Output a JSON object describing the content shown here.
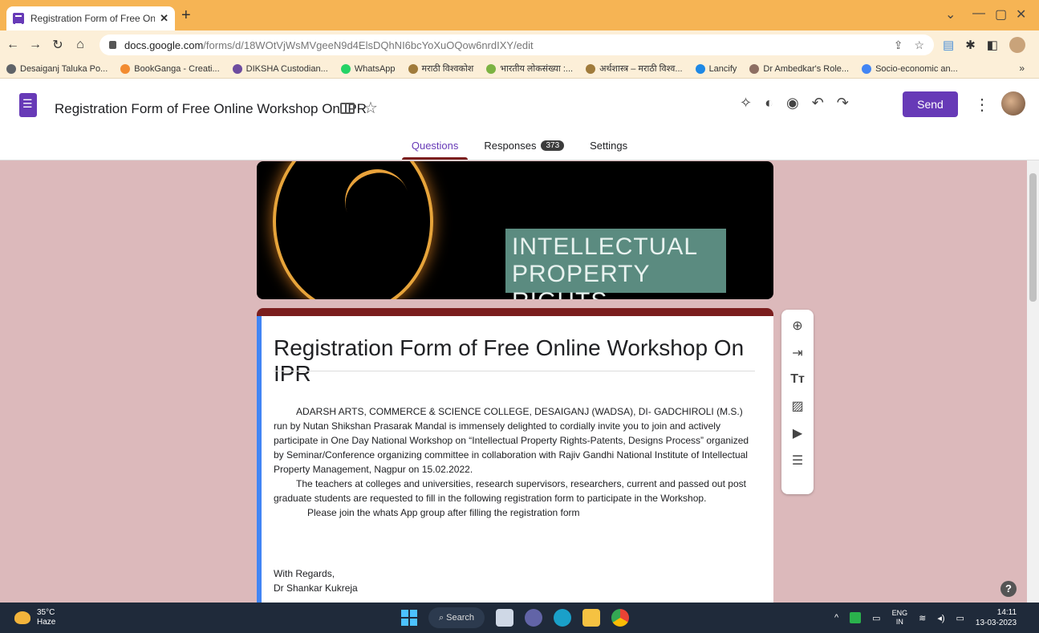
{
  "browser": {
    "tab_title": "Registration Form of Free Online",
    "url_host": "docs.google.com",
    "url_path": "/forms/d/18WOtVjWsMVgeeN9d4ElsDQhNI6bcYoXuOQow6nrdIXY/edit",
    "bookmarks": [
      {
        "label": "Desaiganj Taluka Po...",
        "color": "#5f6368"
      },
      {
        "label": "BookGanga - Creati...",
        "color": "#f28b30"
      },
      {
        "label": "DIKSHA Custodian...",
        "color": "#6d4c9f"
      },
      {
        "label": "WhatsApp",
        "color": "#25d366"
      },
      {
        "label": "मराठी विश्वकोश",
        "color": "#a07b3b"
      },
      {
        "label": "भारतीय लोकसंख्या :...",
        "color": "#7cb342"
      },
      {
        "label": "अर्थशास्त्र – मराठी विश्व...",
        "color": "#a07b3b"
      },
      {
        "label": "Lancify",
        "color": "#1e88e5"
      },
      {
        "label": "Dr Ambedkar's Role...",
        "color": "#8d6e63"
      },
      {
        "label": "Socio-economic an...",
        "color": "#4285f4"
      }
    ],
    "bookmarks_more": "»"
  },
  "header": {
    "doc_title": "Registration Form of Free Online Workshop On IPR",
    "send_label": "Send",
    "tabs": [
      {
        "label": "Questions",
        "active": true
      },
      {
        "label": "Responses",
        "badge": "373"
      },
      {
        "label": "Settings"
      }
    ]
  },
  "banner": {
    "text_line1": "INTELLECTUAL",
    "text_line2": "PROPERTY RIGHTS"
  },
  "form": {
    "title": "Registration Form of Free Online Workshop On IPR",
    "para1": "ADARSH ARTS, COMMERCE & SCIENCE COLLEGE, DESAIGANJ (WADSA), DI- GADCHIROLI (M.S.) run by Nutan Shikshan Prasarak Mandal is immensely delighted to cordially invite you to join and actively participate in One Day National Workshop on “Intellectual Property Rights-Patents, Designs Process” organized by Seminar/Conference organizing committee in collaboration with Rajiv Gandhi National Institute of Intellectual Property Management, Nagpur  on 15.02.2022.",
    "para2": "The teachers at colleges and universities, research supervisors, researchers, current and passed out post graduate students are requested to fill in the following registration form to participate in the Workshop.",
    "para3": "Please join the whats App group after filling the registration form",
    "regards": "With Regards,",
    "signer": "Dr Shankar Kukreja"
  },
  "taskbar": {
    "temperature": "35°C",
    "weather": "Haze",
    "search_label": "Search",
    "lang_line1": "ENG",
    "lang_line2": "IN",
    "time": "14:11",
    "date": "13-03-2023"
  }
}
